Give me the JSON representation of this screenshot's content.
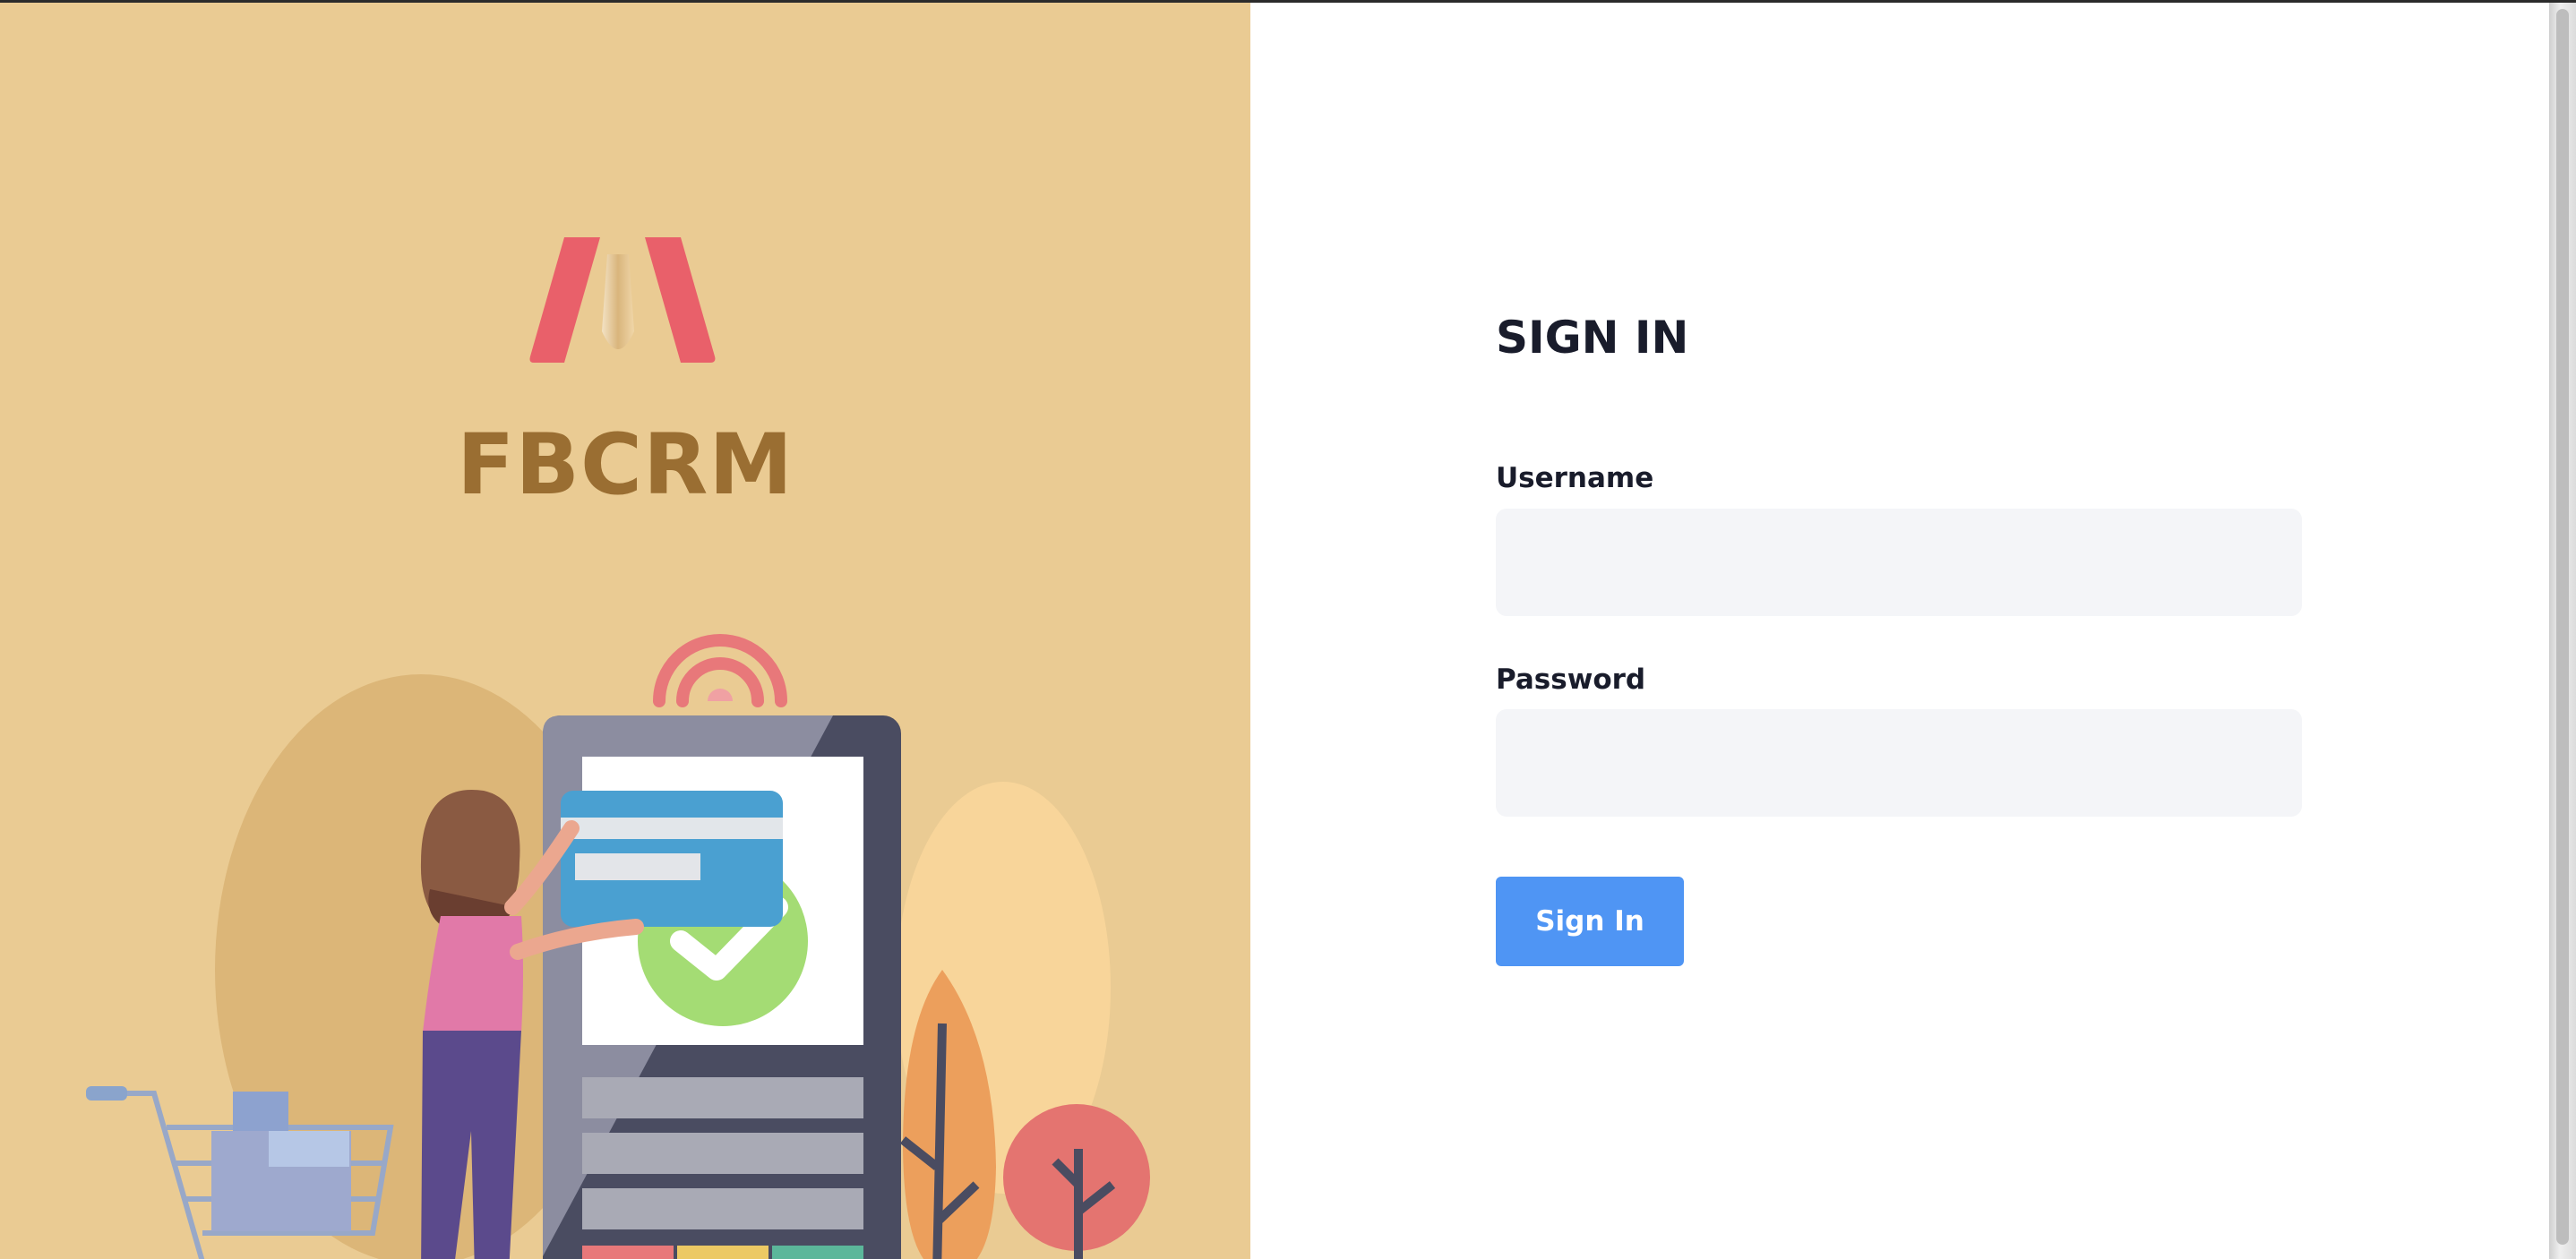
{
  "brand": {
    "name": "FBCRM",
    "logo_icon": "fbcrm-logo-icon",
    "brand_color": "#9a6e32",
    "logo_color": "#e9606a"
  },
  "illustration": {
    "icon": "payment-terminal-illustration",
    "background_color": "#eacb93"
  },
  "form": {
    "title": "SIGN IN",
    "username_label": "Username",
    "username_value": "",
    "password_label": "Password",
    "password_value": "",
    "submit_label": "Sign In",
    "accent_color": "#4f95f4"
  }
}
